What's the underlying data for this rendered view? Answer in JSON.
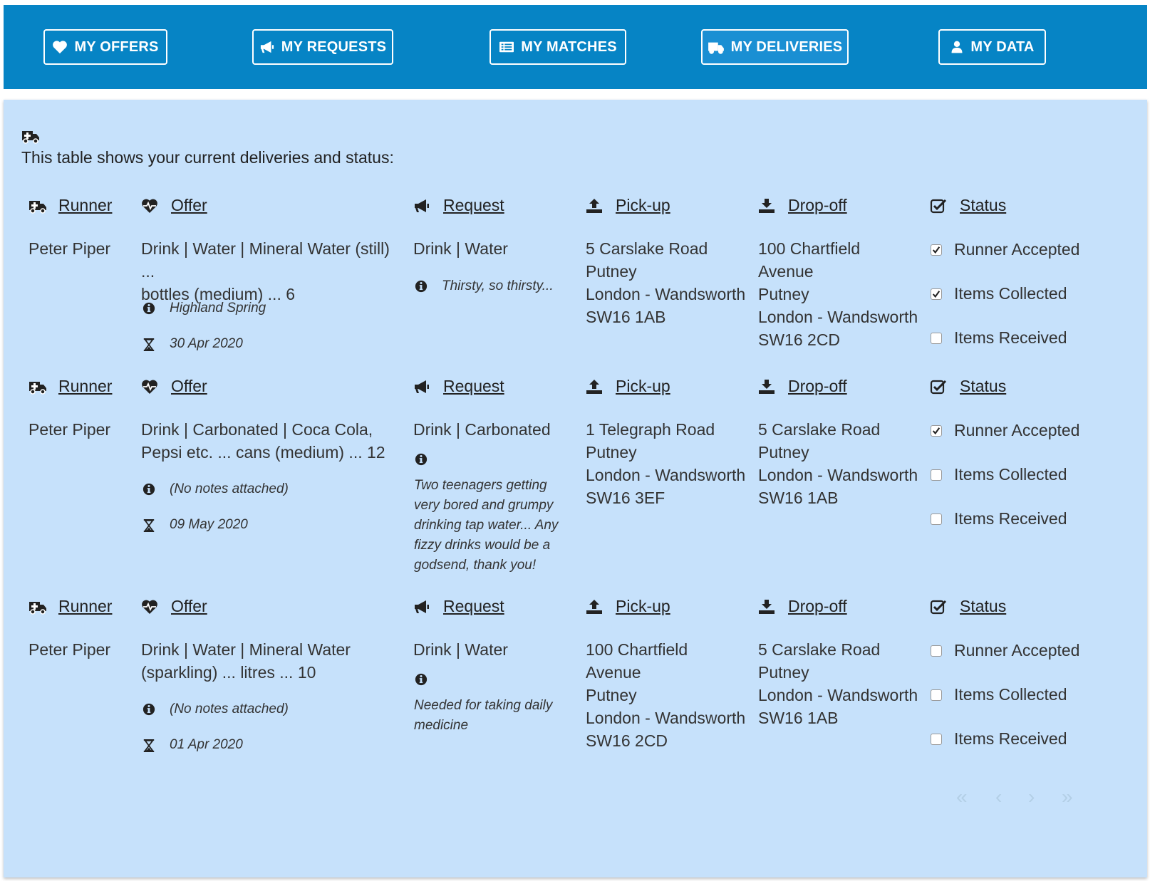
{
  "nav": {
    "offers_label": "MY OFFERS",
    "requests_label": "MY REQUESTS",
    "matches_label": "MY MATCHES",
    "deliveries_label": "MY DELIVERIES",
    "data_label": "MY DATA"
  },
  "intro": {
    "text": "This table shows your current deliveries and status:"
  },
  "headers": {
    "runner": "Runner",
    "offer": "Offer",
    "request": "Request",
    "pickup": "Pick-up",
    "dropoff": "Drop-off",
    "status": "Status"
  },
  "status_labels": {
    "accepted": "Runner Accepted",
    "collected": "Items Collected",
    "received": "Items Received"
  },
  "deliveries": [
    {
      "runner": "Peter Piper",
      "offer_line1": "Drink | Water | Mineral Water (still) ...",
      "offer_line2": "bottles (medium) ... 6",
      "offer_note": "Highland Spring",
      "offer_date": "30 Apr 2020",
      "request_title": "Drink | Water",
      "request_note": "Thirsty, so thirsty...",
      "pickup": [
        "5 Carslake Road",
        "Putney",
        "London - Wandsworth",
        "SW16 1AB"
      ],
      "dropoff": [
        "100 Chartfield",
        "Avenue",
        "Putney",
        "London - Wandsworth",
        "SW16 2CD"
      ],
      "status": {
        "accepted": true,
        "collected": true,
        "received": false
      }
    },
    {
      "runner": "Peter Piper",
      "offer_line1": "Drink | Carbonated | Coca Cola,",
      "offer_line2": "Pepsi etc. ... cans (medium) ... 12",
      "offer_note": "(No notes attached)",
      "offer_date": "09 May 2020",
      "request_title": "Drink | Carbonated",
      "request_note_lines": [
        "Two teenagers getting",
        "very bored and grumpy",
        "drinking tap water... Any",
        "fizzy drinks would be a",
        "godsend, thank you!"
      ],
      "pickup": [
        "1 Telegraph Road",
        "Putney",
        "London - Wandsworth",
        "SW16 3EF"
      ],
      "dropoff": [
        "5 Carslake Road",
        "Putney",
        "London - Wandsworth",
        "SW16 1AB"
      ],
      "status": {
        "accepted": true,
        "collected": false,
        "received": false
      }
    },
    {
      "runner": "Peter Piper",
      "offer_line1": "Drink | Water | Mineral Water",
      "offer_line2": "(sparkling) ... litres ... 10",
      "offer_note": "(No notes attached)",
      "offer_date": "01 Apr 2020",
      "request_title": "Drink | Water",
      "request_note_lines": [
        "Needed for taking daily",
        "medicine"
      ],
      "pickup": [
        "100 Chartfield",
        "Avenue",
        "Putney",
        "London - Wandsworth",
        "SW16 2CD"
      ],
      "dropoff": [
        "5 Carslake Road",
        "Putney",
        "London - Wandsworth",
        "SW16 1AB"
      ],
      "status": {
        "accepted": false,
        "collected": false,
        "received": false
      }
    }
  ],
  "pager": {
    "first": "«",
    "prev": "‹",
    "next": "›",
    "last": "»"
  },
  "icons": {
    "offers": "heartbeat-icon",
    "requests": "bullhorn-icon",
    "matches": "list-icon",
    "deliveries": "ambulance-icon",
    "data": "user-icon",
    "info": "info-circle-icon",
    "date": "hourglass-icon",
    "pickup": "upload-icon",
    "dropoff": "download-icon",
    "status": "check-square-icon"
  },
  "colors": {
    "navbar": "#0684c5",
    "panel": "#c6e1fb"
  }
}
